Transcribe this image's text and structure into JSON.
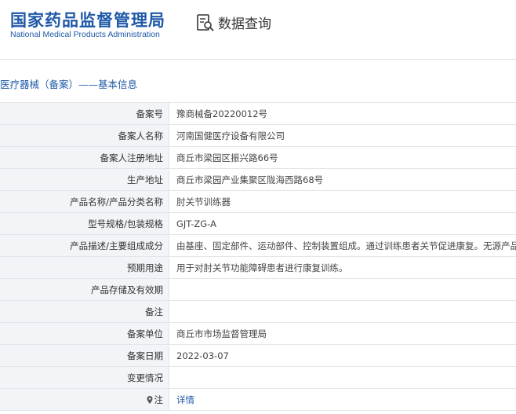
{
  "header": {
    "logo_cn": "国家药品监督管理局",
    "logo_en": "National Medical Products Administration",
    "query_label": "数据查询",
    "brand_color": "#1f59a8"
  },
  "section_title": "医疗器械（备案）——基本信息",
  "rows": [
    {
      "label": "备案号",
      "value": "豫商械备20220012号"
    },
    {
      "label": "备案人名称",
      "value": "河南国健医疗设备有限公司"
    },
    {
      "label": "备案人注册地址",
      "value": "商丘市梁园区振兴路66号"
    },
    {
      "label": "生产地址",
      "value": "商丘市梁园产业集聚区陇海西路68号"
    },
    {
      "label": "产品名称/产品分类名称",
      "value": "肘关节训练器"
    },
    {
      "label": "型号规格/包装规格",
      "value": "GJT-ZG-A"
    },
    {
      "label": "产品描述/主要组成成分",
      "value": "由基座、固定部件、运动部件、控制装置组成。通过训练患者关节促进康复。无源产品。"
    },
    {
      "label": "预期用途",
      "value": "用于对肘关节功能障碍患者进行康复训练。"
    },
    {
      "label": "产品存储及有效期",
      "value": ""
    },
    {
      "label": "备注",
      "value": ""
    },
    {
      "label": "备案单位",
      "value": "商丘市市场监督管理局"
    },
    {
      "label": "备案日期",
      "value": "2022-03-07"
    },
    {
      "label": "变更情况",
      "value": ""
    }
  ],
  "note_row": {
    "label": "注",
    "link": "详情",
    "icon": "pin-icon"
  }
}
